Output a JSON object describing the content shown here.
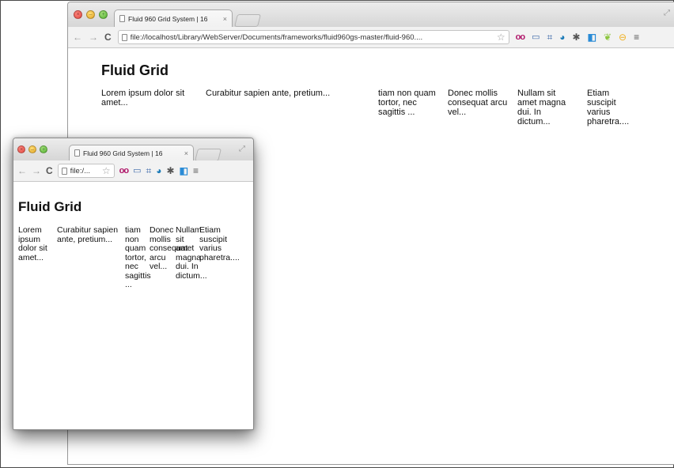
{
  "browser": {
    "tab_title": "Fluid 960 Grid System | 16",
    "tab_close": "×",
    "url": "file://localhost/Library/WebServer/Documents/frameworks/fluid960gs-master/fluid-960....",
    "url_small": "file:/..."
  },
  "page": {
    "title": "Fluid Grid",
    "columns": [
      "Lorem ipsum dolor sit amet...",
      "Curabitur sapien ante, pretium...",
      "tiam non quam tortor, nec sagittis ...",
      "Donec mollis consequat arcu vel...",
      "Nullam sit amet magna dui. In dictum...",
      "Etiam suscipit varius pharetra...."
    ]
  },
  "icons": {
    "back": "←",
    "forward": "→",
    "reload": "C",
    "star": "☆",
    "menu": "≡"
  }
}
